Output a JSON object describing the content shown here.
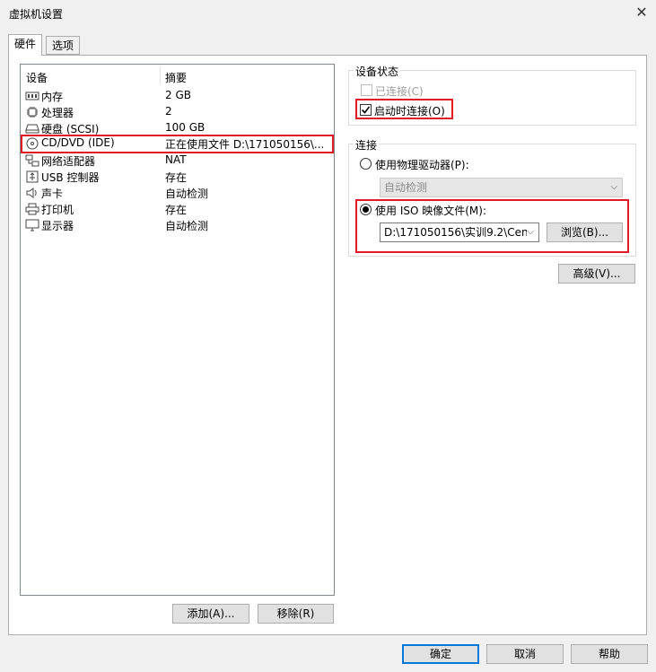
{
  "window": {
    "title": "虚拟机设置",
    "close_glyph": "✕"
  },
  "tabs": [
    {
      "label": "硬件",
      "active": true
    },
    {
      "label": "选项",
      "active": false
    }
  ],
  "device_list": {
    "headers": {
      "device": "设备",
      "summary": "摘要"
    },
    "rows": [
      {
        "icon": "memory-icon",
        "name": "内存",
        "summary": "2 GB"
      },
      {
        "icon": "processor-icon",
        "name": "处理器",
        "summary": "2"
      },
      {
        "icon": "hard-disk-icon",
        "name": "硬盘 (SCSI)",
        "summary": "100 GB"
      },
      {
        "icon": "cd-dvd-icon",
        "name": "CD/DVD (IDE)",
        "summary": "正在使用文件 D:\\171050156\\...",
        "selected": true
      },
      {
        "icon": "network-adapter-icon",
        "name": "网络适配器",
        "summary": "NAT"
      },
      {
        "icon": "usb-icon",
        "name": "USB 控制器",
        "summary": "存在"
      },
      {
        "icon": "sound-card-icon",
        "name": "声卡",
        "summary": "自动检测"
      },
      {
        "icon": "printer-icon",
        "name": "打印机",
        "summary": "存在"
      },
      {
        "icon": "display-icon",
        "name": "显示器",
        "summary": "自动检测"
      }
    ]
  },
  "list_buttons": {
    "add": "添加(A)...",
    "remove": "移除(R)"
  },
  "device_status": {
    "title": "设备状态",
    "connected": {
      "label": "已连接(C)",
      "checked": false,
      "enabled": false
    },
    "connect_at_power_on": {
      "label": "启动时连接(O)",
      "checked": true
    }
  },
  "connection": {
    "title": "连接",
    "physical": {
      "label": "使用物理驱动器(P):",
      "selected": false,
      "dropdown_value": "自动检测"
    },
    "iso": {
      "label": "使用 ISO 映像文件(M):",
      "selected": true,
      "path_value": "D:\\171050156\\实训9.2\\Cen",
      "browse": "浏览(B)..."
    }
  },
  "advanced_button": "高级(V)...",
  "footer": {
    "ok": "确定",
    "cancel": "取消",
    "help": "帮助"
  },
  "colors": {
    "highlight_red": "#e01b24",
    "focus_blue": "#0078d7"
  }
}
